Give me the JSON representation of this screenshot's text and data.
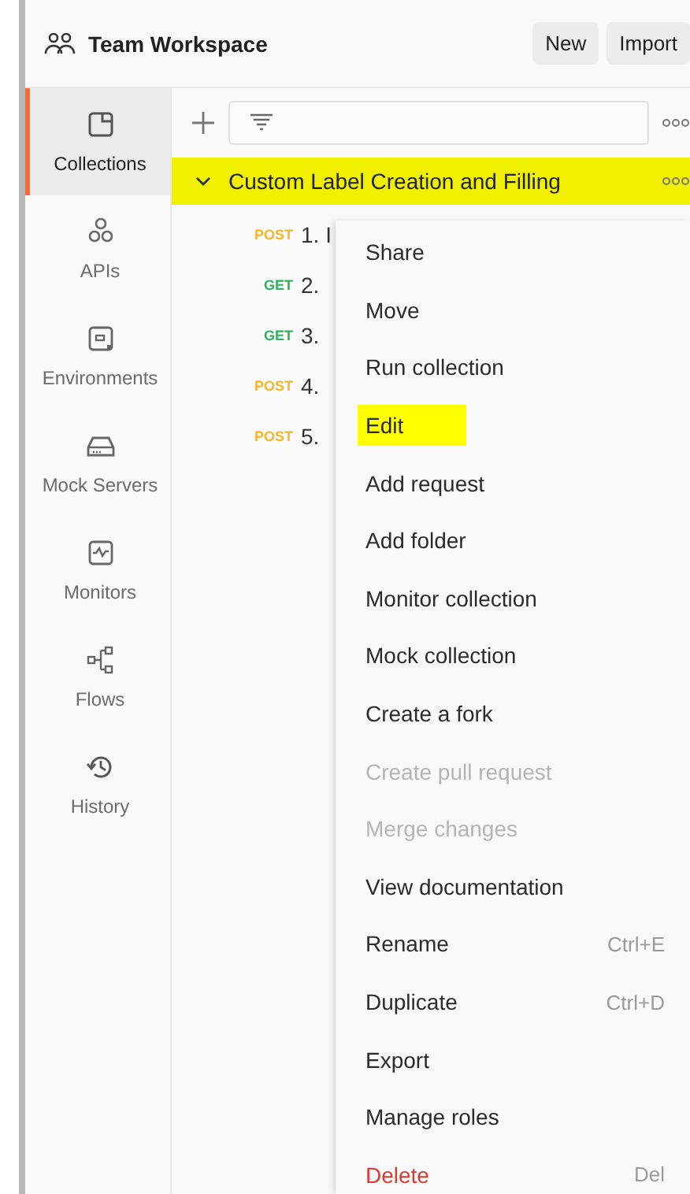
{
  "header": {
    "title": "Team Workspace",
    "buttons": [
      "New",
      "Import"
    ]
  },
  "sidebar": {
    "items": [
      {
        "label": "Collections",
        "selected": true
      },
      {
        "label": "APIs",
        "selected": false
      },
      {
        "label": "Environments",
        "selected": false
      },
      {
        "label": "Mock Servers",
        "selected": false
      },
      {
        "label": "Monitors",
        "selected": false
      },
      {
        "label": "Flows",
        "selected": false
      },
      {
        "label": "History",
        "selected": false
      }
    ]
  },
  "collection": {
    "name": "Custom Label Creation and Filling",
    "expanded": true,
    "highlighted": true,
    "requests": [
      {
        "method": "POST",
        "name": "1. I"
      },
      {
        "method": "GET",
        "name": "2."
      },
      {
        "method": "GET",
        "name": "3."
      },
      {
        "method": "POST",
        "name": "4."
      },
      {
        "method": "POST",
        "name": "5."
      }
    ]
  },
  "context_menu": {
    "items": [
      {
        "label": "Share",
        "kind": "normal",
        "disabled": false,
        "highlighted": false
      },
      {
        "label": "Move",
        "kind": "normal",
        "disabled": false,
        "highlighted": false
      },
      {
        "label": "Run collection",
        "kind": "normal",
        "disabled": false,
        "highlighted": false
      },
      {
        "label": "Edit",
        "kind": "normal",
        "disabled": false,
        "highlighted": true
      },
      {
        "label": "Add request",
        "kind": "normal",
        "disabled": false,
        "highlighted": false
      },
      {
        "label": "Add folder",
        "kind": "normal",
        "disabled": false,
        "highlighted": false
      },
      {
        "label": "Monitor collection",
        "kind": "normal",
        "disabled": false,
        "highlighted": false
      },
      {
        "label": "Mock collection",
        "kind": "normal",
        "disabled": false,
        "highlighted": false
      },
      {
        "label": "Create a fork",
        "kind": "normal",
        "disabled": false,
        "highlighted": false
      },
      {
        "label": "Create pull request",
        "kind": "normal",
        "disabled": true,
        "highlighted": false
      },
      {
        "label": "Merge changes",
        "kind": "normal",
        "disabled": true,
        "highlighted": false
      },
      {
        "label": "View documentation",
        "kind": "normal",
        "disabled": false,
        "highlighted": false
      },
      {
        "label": "Rename",
        "kind": "normal",
        "disabled": false,
        "highlighted": false,
        "shortcut": "Ctrl+E"
      },
      {
        "label": "Duplicate",
        "kind": "normal",
        "disabled": false,
        "highlighted": false,
        "shortcut": "Ctrl+D"
      },
      {
        "label": "Export",
        "kind": "normal",
        "disabled": false,
        "highlighted": false
      },
      {
        "label": "Manage roles",
        "kind": "normal",
        "disabled": false,
        "highlighted": false
      },
      {
        "label": "Delete",
        "kind": "danger",
        "disabled": false,
        "highlighted": false,
        "shortcut": "Del"
      }
    ]
  }
}
